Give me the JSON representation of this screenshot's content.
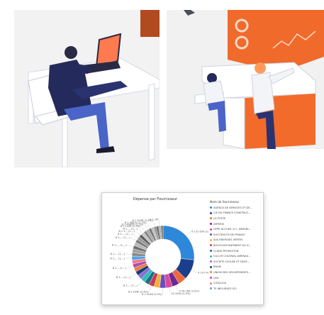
{
  "chart_data": {
    "type": "pie",
    "title": "Dépense par Fournisseur",
    "legend_title": "Nom du fournisseur",
    "legend": [
      {
        "name": "AGENCE DE SERVICES ET DE...",
        "color": "#2e88d9"
      },
      {
        "name": "CIE DU FRANCE CONSTRUC...",
        "color": "#1b3f8c"
      },
      {
        "name": "LA POSTE",
        "color": "#ef6a3a"
      },
      {
        "name": "ARTERIS",
        "color": "#6b2b8f"
      },
      {
        "name": "HYPR ACCUEIL & C. IMMOBI...",
        "color": "#d9489a"
      },
      {
        "name": "ELECTRICITE DE FRANCE",
        "color": "#6a4cc2"
      },
      {
        "name": "SAS ENERGIES VERTES",
        "color": "#f2b134"
      },
      {
        "name": "BOUYGUES BATIMENT ILE D...",
        "color": "#c93a56"
      },
      {
        "name": "CLADE PROMOTION",
        "color": "#1f6e8c"
      },
      {
        "name": "F.A.G.M COLONIAL AMENAG...",
        "color": "#2dbfb0"
      },
      {
        "name": "SOCIETE CIVILISE ET DEVE...",
        "color": "#8a6dd8"
      },
      {
        "name": "ENGIE",
        "color": "#1c3a78"
      },
      {
        "name": "UNION DES GROUPEMENTS...",
        "color": "#e8803a"
      },
      {
        "name": "LNH",
        "color": "#b24cb0"
      },
      {
        "name": "CITALLIOS",
        "color": "#f07a8c"
      },
      {
        "name": "TE INFLUENCE SCI",
        "color": "#4fa3e8"
      }
    ],
    "slices": [
      {
        "color": "#2e88d9",
        "value": 25,
        "label": "6 131 654 (22,6%)"
      },
      {
        "color": "#1b3f8c",
        "value": 10,
        "label": "4 157 949 (10,5%)"
      },
      {
        "color": "#ef6a3a",
        "value": 4
      },
      {
        "color": "#6b2b8f",
        "value": 3.5,
        "label": "4 76 789 (3,5%)"
      },
      {
        "color": "#d9489a",
        "value": 3.2,
        "label": "10 3284 (2,9%)"
      },
      {
        "color": "#6a4cc2",
        "value": 3,
        "label": "8 3 3246 (2,9%)"
      },
      {
        "color": "#f2b134",
        "value": 2.8
      },
      {
        "color": "#c93a56",
        "value": 2.6,
        "label": "8 3 2040 (2,4%)"
      },
      {
        "color": "#1f6e8c",
        "value": 2.4
      },
      {
        "color": "#2dbfb0",
        "value": 2.3,
        "label": "8 1,... (1,...)"
      },
      {
        "color": "#8a6dd8",
        "value": 2.2
      },
      {
        "color": "#1c3a78",
        "value": 2.1,
        "label": "8 1,... (1,...)"
      },
      {
        "color": "#e8803a",
        "value": 2
      },
      {
        "color": "#b24cb0",
        "value": 2,
        "label": "8 2... (1,...)"
      },
      {
        "color": "#f07a8c",
        "value": 1.9
      },
      {
        "color": "#4fa3e8",
        "value": 1.9,
        "label": "8 1,... (1,...)"
      },
      {
        "color": "#8c8c8c",
        "value": 1.8,
        "label": "8 1,... (1,...)"
      },
      {
        "color": "#a0a0a0",
        "value": 1.8
      },
      {
        "color": "#6f6f6f",
        "value": 1.7,
        "label": "8 1,... (1,...)"
      },
      {
        "color": "#b8b8b8",
        "value": 1.7
      },
      {
        "color": "#7d7d7d",
        "value": 1.6,
        "label": "8 1,... (1,...)"
      },
      {
        "color": "#9a9a9a",
        "value": 1.6,
        "label": "8 1,... (1,...)"
      },
      {
        "color": "#5e5e5e",
        "value": 1.5,
        "label": "8 1 1... (1,...)"
      },
      {
        "color": "#c4c4c4",
        "value": 1.5,
        "label": "8 1,... (1,...)"
      },
      {
        "color": "#868686",
        "value": 1.4,
        "label": "8 1 1245 (1,1%)"
      },
      {
        "color": "#a9a9a9",
        "value": 1.4,
        "label": "8 1 49426 (1,5%)"
      },
      {
        "color": "#737373",
        "value": 1.3,
        "label": "8 1 48034 (1,4%)"
      },
      {
        "color": "#bdbdbd",
        "value": 1.3
      },
      {
        "color": "#909090",
        "value": 1.2,
        "label": "8 1 5248 (0,9%)"
      },
      {
        "color": "#6a6a6a",
        "value": 1.2
      },
      {
        "color": "#b0b0b0",
        "value": 1.1,
        "label": "8 1 1M"
      },
      {
        "color": "#7a7a7a",
        "value": 1.1
      }
    ]
  }
}
